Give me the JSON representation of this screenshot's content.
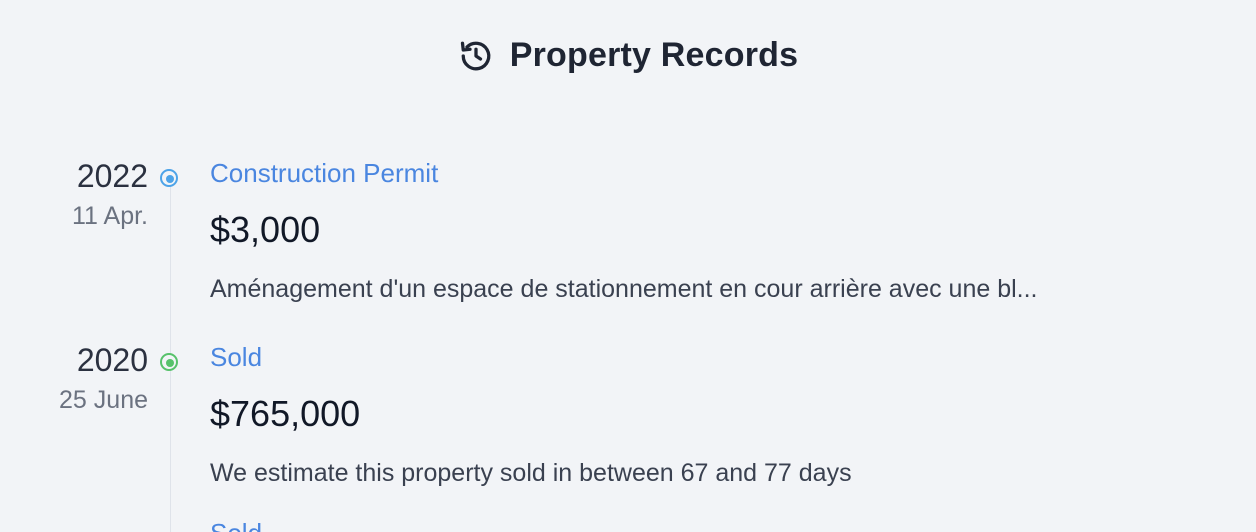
{
  "header": {
    "title": "Property Records",
    "icon": "history-icon"
  },
  "records": [
    {
      "year": "2022",
      "day": "11 Apr.",
      "type": "Construction Permit",
      "price": "$3,000",
      "description": "Aménagement d'un espace de stationnement en cour arrière avec une bl...",
      "dot_color": "#4da3e8"
    },
    {
      "year": "2020",
      "day": "25 June",
      "type": "Sold",
      "price": "$765,000",
      "description": "We estimate this property sold in between 67 and 77 days",
      "dot_color": "#57c26b"
    },
    {
      "type": "Sold"
    }
  ],
  "colors": {
    "background": "#f2f4f7",
    "accent": "#4a86e0",
    "text": "#1f2533"
  }
}
